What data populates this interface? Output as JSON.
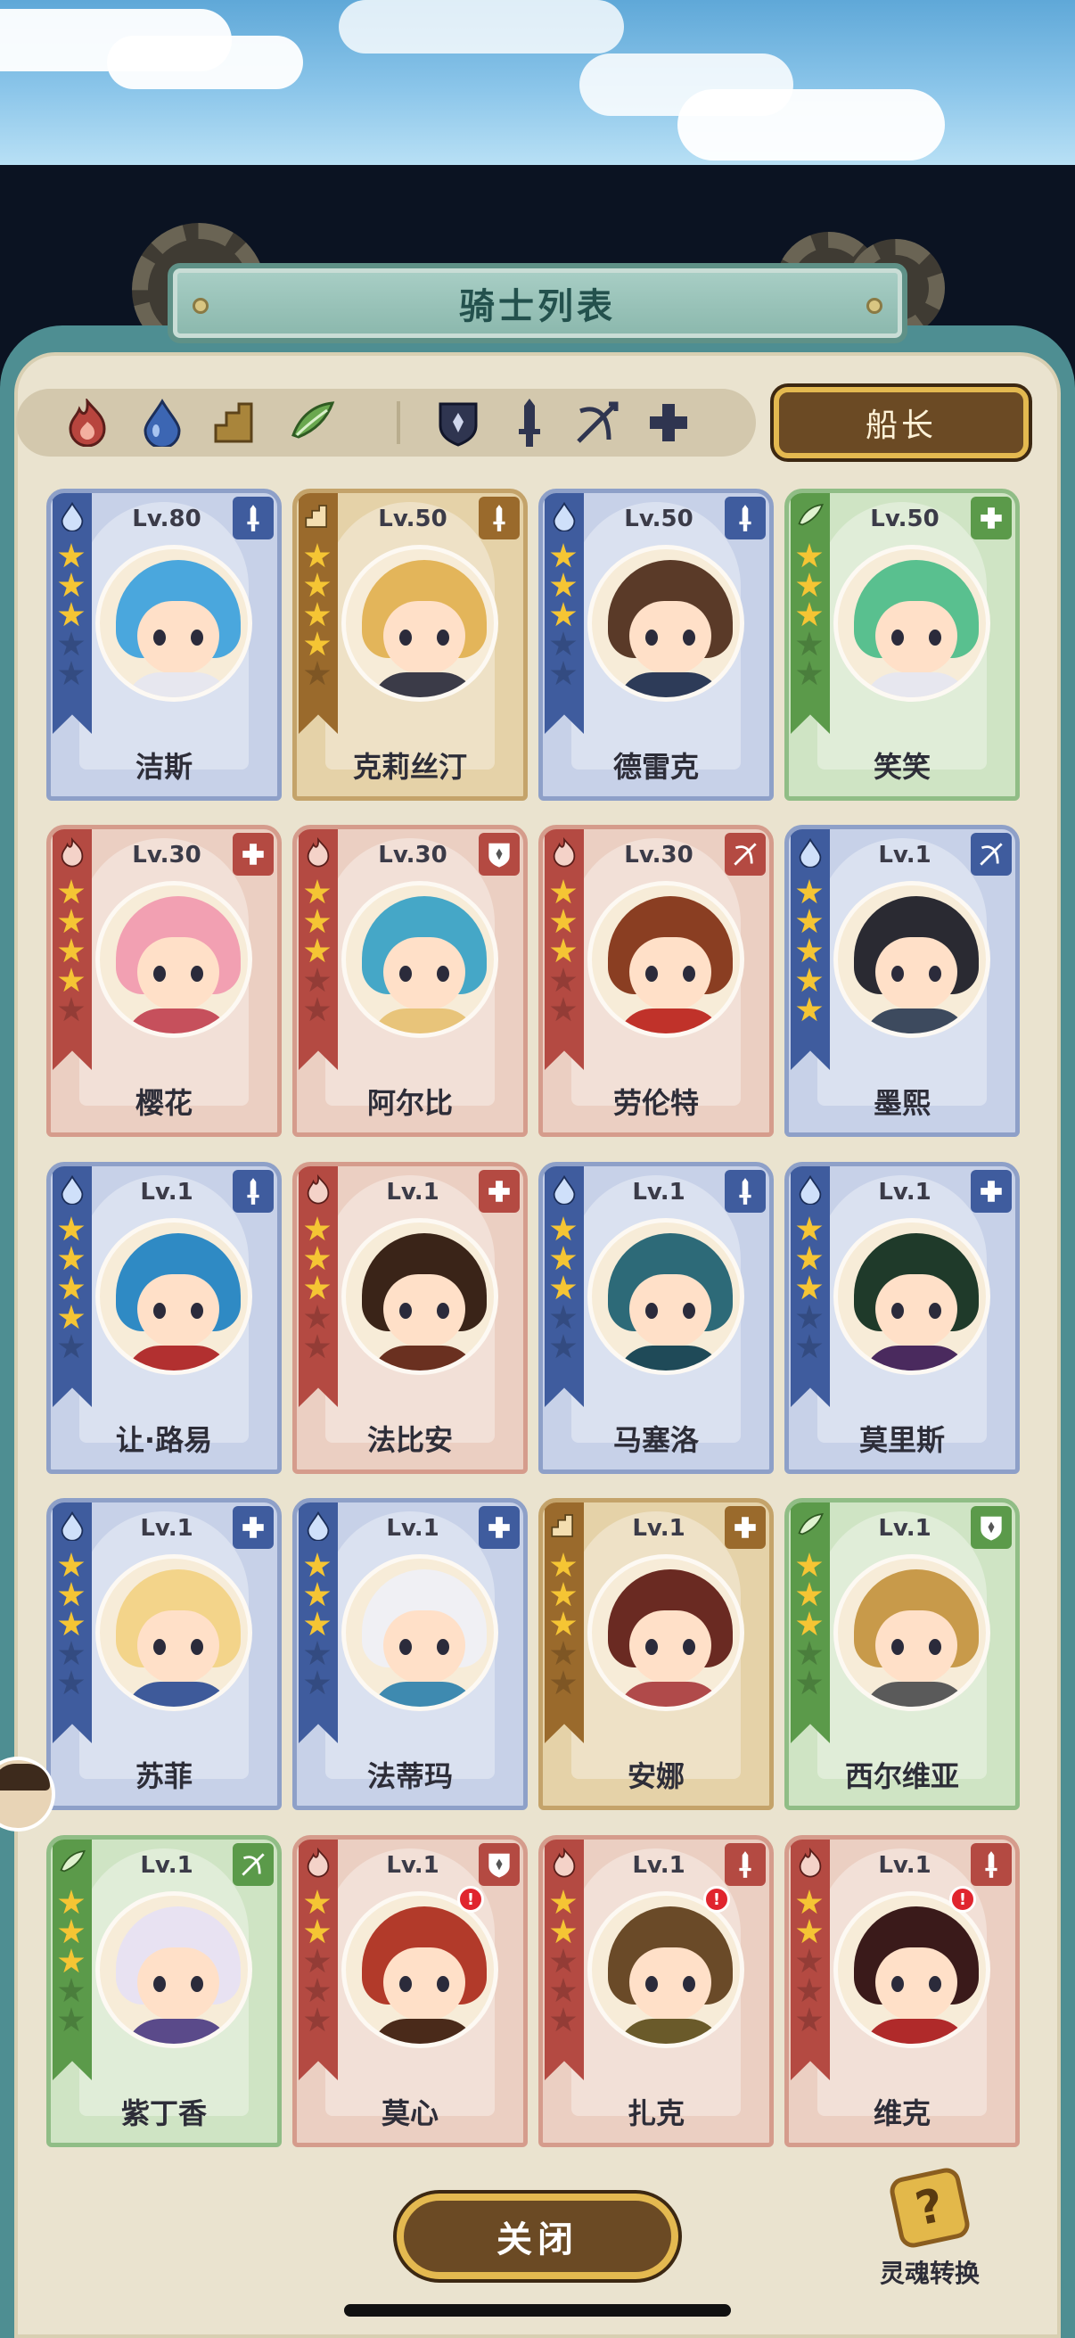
{
  "title": "骑士列表",
  "captain_button": "船长",
  "close_button": "关闭",
  "soul_convert_label": "灵魂转换",
  "filters": {
    "elements": [
      {
        "name": "fire",
        "color": "#b8453e"
      },
      {
        "name": "water",
        "color": "#3c66b3"
      },
      {
        "name": "earth",
        "color": "#a9853b"
      },
      {
        "name": "wind",
        "color": "#6aa84f"
      }
    ],
    "classes": [
      "shield",
      "sword",
      "bow",
      "cross"
    ]
  },
  "colors": {
    "water": "#3f5c9e",
    "fire": "#b44a42",
    "earth": "#9a6a2c",
    "wind": "#5b9a4a",
    "star": "#f5c534",
    "captain_border": "#e4b950"
  },
  "knights": [
    {
      "name": "洁斯",
      "level": "Lv.80",
      "element": "water",
      "class": "sword",
      "stars": 3,
      "hair": "#4aa7dd",
      "outfit": "#e7e7ef",
      "alert": false
    },
    {
      "name": "克莉丝汀",
      "level": "Lv.50",
      "element": "earth",
      "class": "sword",
      "stars": 4,
      "hair": "#e3b55a",
      "outfit": "#3b3b48",
      "alert": false
    },
    {
      "name": "德雷克",
      "level": "Lv.50",
      "element": "water",
      "class": "sword",
      "stars": 3,
      "hair": "#5a3a28",
      "outfit": "#2d3b58",
      "alert": false
    },
    {
      "name": "笑笑",
      "level": "Lv.50",
      "element": "wind",
      "class": "cross",
      "stars": 3,
      "hair": "#59c08f",
      "outfit": "#e7e7ef",
      "alert": false
    },
    {
      "name": "樱花",
      "level": "Lv.30",
      "element": "fire",
      "class": "cross",
      "stars": 4,
      "hair": "#f2a0b2",
      "outfit": "#c6505c",
      "alert": false
    },
    {
      "name": "阿尔比",
      "level": "Lv.30",
      "element": "fire",
      "class": "shield",
      "stars": 3,
      "hair": "#45a7c7",
      "outfit": "#e8c47a",
      "alert": false
    },
    {
      "name": "劳伦特",
      "level": "Lv.30",
      "element": "fire",
      "class": "bow",
      "stars": 3,
      "hair": "#8a3e22",
      "outfit": "#c0322a",
      "alert": false
    },
    {
      "name": "墨熙",
      "level": "Lv.1",
      "element": "water",
      "class": "bow",
      "stars": 5,
      "hair": "#2a2a32",
      "outfit": "#3d4a5e",
      "alert": false
    },
    {
      "name": "让·路易",
      "level": "Lv.1",
      "element": "water",
      "class": "sword",
      "stars": 4,
      "hair": "#2f8ac4",
      "outfit": "#b23030",
      "alert": false
    },
    {
      "name": "法比安",
      "level": "Lv.1",
      "element": "fire",
      "class": "cross",
      "stars": 3,
      "hair": "#3a2418",
      "outfit": "#6a3020",
      "alert": false
    },
    {
      "name": "马塞洛",
      "level": "Lv.1",
      "element": "water",
      "class": "sword",
      "stars": 3,
      "hair": "#2d6a78",
      "outfit": "#1f4a58",
      "alert": false
    },
    {
      "name": "莫里斯",
      "level": "Lv.1",
      "element": "water",
      "class": "cross",
      "stars": 3,
      "hair": "#1f3a2a",
      "outfit": "#4a2a5e",
      "alert": false
    },
    {
      "name": "苏菲",
      "level": "Lv.1",
      "element": "water",
      "class": "cross",
      "stars": 3,
      "hair": "#f3d48a",
      "outfit": "#3e5a9a",
      "alert": false
    },
    {
      "name": "法蒂玛",
      "level": "Lv.1",
      "element": "water",
      "class": "cross",
      "stars": 3,
      "hair": "#f0f0f4",
      "outfit": "#3e8ab0",
      "alert": false
    },
    {
      "name": "安娜",
      "level": "Lv.1",
      "element": "earth",
      "class": "cross",
      "stars": 3,
      "hair": "#6a2a22",
      "outfit": "#b04a4a",
      "alert": false
    },
    {
      "name": "西尔维亚",
      "level": "Lv.1",
      "element": "wind",
      "class": "shield",
      "stars": 3,
      "hair": "#c89a4a",
      "outfit": "#5a5a5a",
      "alert": false
    },
    {
      "name": "紫丁香",
      "level": "Lv.1",
      "element": "wind",
      "class": "bow",
      "stars": 3,
      "hair": "#e8e2f2",
      "outfit": "#5a4a8a",
      "alert": false
    },
    {
      "name": "莫心",
      "level": "Lv.1",
      "element": "fire",
      "class": "shield",
      "stars": 2,
      "hair": "#b23a2a",
      "outfit": "#4a2a1a",
      "alert": true
    },
    {
      "name": "扎克",
      "level": "Lv.1",
      "element": "fire",
      "class": "sword",
      "stars": 2,
      "hair": "#6a4a28",
      "outfit": "#6a5a2a",
      "alert": true
    },
    {
      "name": "维克",
      "level": "Lv.1",
      "element": "fire",
      "class": "sword",
      "stars": 2,
      "hair": "#3a1a1a",
      "outfit": "#b02a2a",
      "alert": true
    }
  ]
}
